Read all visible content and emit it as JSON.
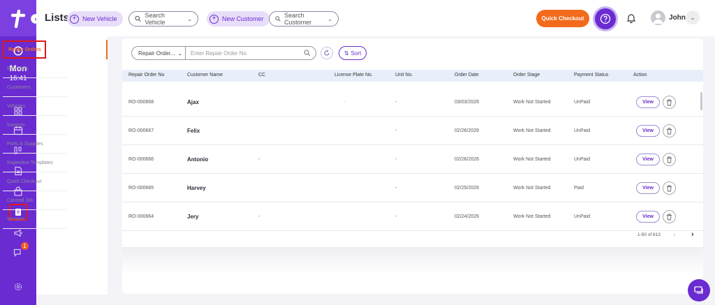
{
  "sidebar_rail": {
    "day": "Mon",
    "time": "16:41",
    "notification_count": "1",
    "icons": [
      "clock-icon",
      "dashboard-icon",
      "calendar-icon",
      "board-icon",
      "document-icon",
      "bag-icon",
      "lists-icon",
      "megaphone-icon",
      "chat-icon",
      "settings-icon"
    ]
  },
  "header": {
    "title": "Lists",
    "new_vehicle": "New Vehicle",
    "search_vehicle": "Search Vehicle",
    "new_customer": "New Customer",
    "search_customer": "Search Customer",
    "quick_checkout": "Quick Checkout",
    "user_name": "John"
  },
  "subnav": {
    "items": [
      {
        "label": "Repair Orders"
      },
      {
        "label": "Estimates"
      },
      {
        "label": "Customers"
      },
      {
        "label": "Vehicles"
      },
      {
        "label": "Invoices"
      },
      {
        "label": "Parts & Supplies"
      },
      {
        "label": "Inspection Templates"
      },
      {
        "label": "Quick Checkout"
      },
      {
        "label": "Canned Job"
      },
      {
        "label": "Vendors"
      }
    ]
  },
  "filters": {
    "select_value": "Repair Order...",
    "search_placeholder": "Enter Repair Order No",
    "sort_label": "Sort"
  },
  "table": {
    "headers": [
      "Repair Order No",
      "Customer Name",
      "CC",
      "License Plate No.",
      "Unit No.",
      "Order Date",
      "Order Stage",
      "Payment Status",
      "Action"
    ],
    "rows": [
      {
        "ro": "RO-000668",
        "name": "Ajax",
        "cc": "",
        "plate": "-",
        "unit": "-",
        "date": "03/03/2026",
        "stage": "Work Not Started",
        "payment": "UnPaid"
      },
      {
        "ro": "RO-000667",
        "name": "Felix",
        "cc": "",
        "plate": "",
        "unit": "-",
        "date": "02/26/2026",
        "stage": "Work Not Started",
        "payment": "UnPaid"
      },
      {
        "ro": "RO-000666",
        "name": "Antonio",
        "cc": "-",
        "plate": "",
        "unit": "-",
        "date": "02/26/2026",
        "stage": "Work Not Started",
        "payment": "UnPaid"
      },
      {
        "ro": "RO-000665",
        "name": "Harvey",
        "cc": "",
        "plate": "",
        "unit": "-",
        "date": "02/25/2026",
        "stage": "Work Not Started",
        "payment": "Paid"
      },
      {
        "ro": "RO-000664",
        "name": "Jery",
        "cc": "-",
        "plate": "",
        "unit": "-",
        "date": "02/24/2026",
        "stage": "Work Not Started",
        "payment": "UnPaid"
      }
    ],
    "view_label": "View"
  },
  "pagination": {
    "summary": "1-50 of 613"
  },
  "colors": {
    "brand_purple": "#6a2bd1",
    "accent_orange": "#f26a1b",
    "highlight_red": "#e01818"
  }
}
